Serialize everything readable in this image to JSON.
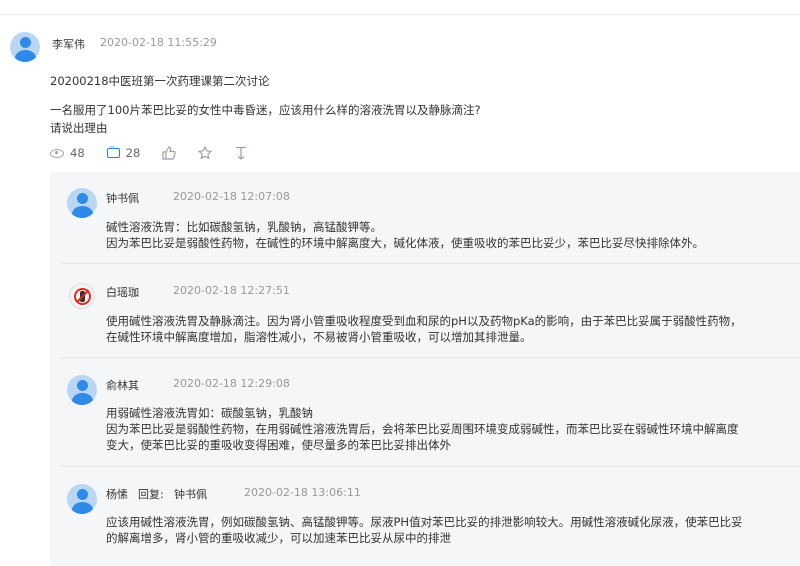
{
  "post": {
    "author": "李军伟",
    "time": "2020-02-18 11:55:29",
    "title": "20200218中医班第一次药理课第二次讨论",
    "body_line1": "一名服用了100片苯巴比妥的女性中毒昏迷，应该用什么样的溶液洗胃以及静脉滴注?",
    "body_line2": "请说出理由",
    "views": "48",
    "comments": "28",
    "icons": [
      "eye-icon",
      "comment-icon",
      "thumbs-up-icon",
      "star-icon",
      "thumbs-down-icon"
    ]
  },
  "replies": [
    {
      "author": "钟书佩",
      "time": "2020-02-18 12:07:08",
      "lines": [
        "碱性溶液洗胃：比如碳酸氢钠，乳酸钠，高锰酸钾等。",
        "因为苯巴比妥是弱酸性药物，在碱性的环境中解离度大，碱化体液，使重吸收的苯巴比妥少，苯巴比妥尽快排除体外。"
      ]
    },
    {
      "author": "白瑶珈",
      "time": "2020-02-18 12:27:51",
      "lines": [
        "使用碱性溶液洗胃及静脉滴注。因为肾小管重吸收程度受到血和尿的pH以及药物pKa的影响，由于苯巴比妥属于弱酸性药物，",
        "在碱性环境中解离度增加，脂溶性减小，不易被肾小管重吸收，可以增加其排泄量。"
      ]
    },
    {
      "author": "俞林其",
      "time": "2020-02-18 12:29:08",
      "lines": [
        "用弱碱性溶液洗胃如：碳酸氢钠，乳酸钠",
        "因为苯巴比妥是弱酸性药物，在用弱碱性溶液洗胃后，会将苯巴比妥周围环境变成弱碱性，而苯巴比妥在弱碱性环境中解离度",
        "变大，使苯巴比妥的重吸收变得困难，使尽量多的苯巴比妥排出体外"
      ]
    },
    {
      "author": "杨愫",
      "reply_label": "回复:",
      "reply_to": "钟书佩",
      "time": "2020-02-18 13:06:11",
      "lines": [
        "应该用碱性溶液洗胃，例如碳酸氢钠、高锰酸钾等。尿液PH值对苯巴比妥的排泄影响较大。用碱性溶液碱化尿液，使苯巴比妥",
        "的解离增多，肾小管的重吸收减少，可以加速苯巴比妥从尿中的排泄"
      ]
    }
  ]
}
